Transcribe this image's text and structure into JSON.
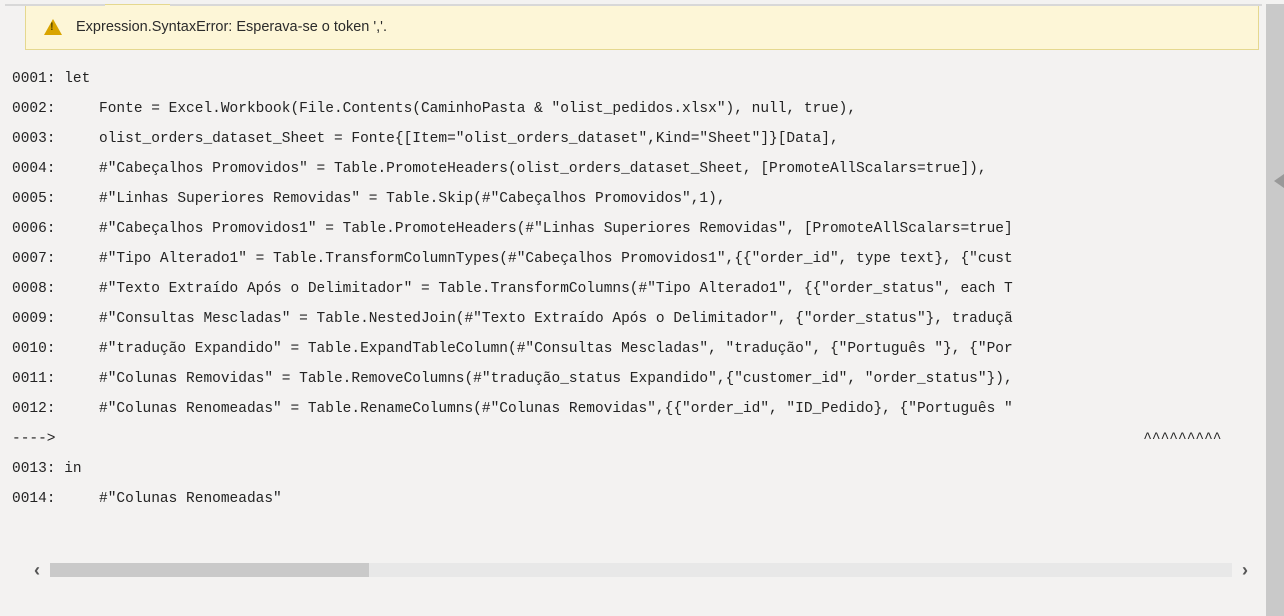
{
  "error": {
    "message": "Expression.SyntaxError: Esperava-se o token ','."
  },
  "code": {
    "lines": [
      {
        "num": "0001:",
        "text": " let"
      },
      {
        "num": "0002:",
        "text": "     Fonte = Excel.Workbook(File.Contents(CaminhoPasta & \"olist_pedidos.xlsx\"), null, true),"
      },
      {
        "num": "0003:",
        "text": "     olist_orders_dataset_Sheet = Fonte{[Item=\"olist_orders_dataset\",Kind=\"Sheet\"]}[Data],"
      },
      {
        "num": "0004:",
        "text": "     #\"Cabeçalhos Promovidos\" = Table.PromoteHeaders(olist_orders_dataset_Sheet, [PromoteAllScalars=true]),"
      },
      {
        "num": "0005:",
        "text": "     #\"Linhas Superiores Removidas\" = Table.Skip(#\"Cabeçalhos Promovidos\",1),"
      },
      {
        "num": "0006:",
        "text": "     #\"Cabeçalhos Promovidos1\" = Table.PromoteHeaders(#\"Linhas Superiores Removidas\", [PromoteAllScalars=true]"
      },
      {
        "num": "0007:",
        "text": "     #\"Tipo Alterado1\" = Table.TransformColumnTypes(#\"Cabeçalhos Promovidos1\",{{\"order_id\", type text}, {\"cust"
      },
      {
        "num": "0008:",
        "text": "     #\"Texto Extraído Após o Delimitador\" = Table.TransformColumns(#\"Tipo Alterado1\", {{\"order_status\", each T"
      },
      {
        "num": "0009:",
        "text": "     #\"Consultas Mescladas\" = Table.NestedJoin(#\"Texto Extraído Após o Delimitador\", {\"order_status\"}, traduçã"
      },
      {
        "num": "0010:",
        "text": "     #\"tradução Expandido\" = Table.ExpandTableColumn(#\"Consultas Mescladas\", \"tradução\", {\"Português \"}, {\"Por"
      },
      {
        "num": "0011:",
        "text": "     #\"Colunas Removidas\" = Table.RemoveColumns(#\"tradução_status Expandido\",{\"customer_id\", \"order_status\"}),"
      },
      {
        "num": "0012:",
        "text": "     #\"Colunas Renomeadas\" = Table.RenameColumns(#\"Colunas Removidas\",{{\"order_id\", \"ID_Pedido}, {\"Português \""
      },
      {
        "num": "---->",
        "text": "                                                                                                                             ^^^^^^^^^"
      },
      {
        "num": "0013:",
        "text": " in"
      },
      {
        "num": "0014:",
        "text": "     #\"Colunas Renomeadas\""
      }
    ]
  }
}
